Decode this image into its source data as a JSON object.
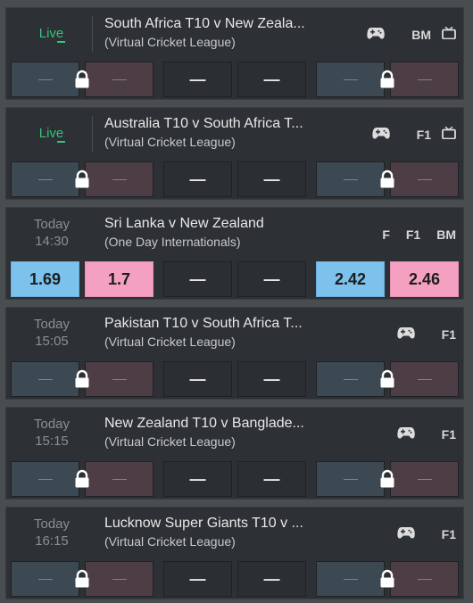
{
  "markets": [
    {
      "status": "live",
      "live_label": "Live",
      "day": "",
      "time": "",
      "title": "South Africa T10 v New Zeala...",
      "competition": "(Virtual Cricket League)",
      "badges": [
        "BM"
      ],
      "has_gamepad": true,
      "has_tv": true,
      "suspended": true,
      "odds": {
        "back1": "",
        "lay1": "",
        "draw_back": "—",
        "draw_lay": "—",
        "back2": "",
        "lay2": ""
      }
    },
    {
      "status": "live",
      "live_label": "Live",
      "day": "",
      "time": "",
      "title": "Australia T10 v South Africa T...",
      "competition": "(Virtual Cricket League)",
      "badges": [
        "F1"
      ],
      "has_gamepad": true,
      "has_tv": true,
      "suspended": true,
      "odds": {
        "back1": "",
        "lay1": "",
        "draw_back": "—",
        "draw_lay": "—",
        "back2": "",
        "lay2": ""
      }
    },
    {
      "status": "scheduled",
      "live_label": "",
      "day": "Today",
      "time": "14:30",
      "title": "Sri Lanka v New Zealand",
      "competition": "(One Day Internationals)",
      "badges": [
        "F",
        "F1",
        "BM"
      ],
      "has_gamepad": false,
      "has_tv": false,
      "suspended": false,
      "odds": {
        "back1": "1.69",
        "lay1": "1.7",
        "draw_back": "—",
        "draw_lay": "—",
        "back2": "2.42",
        "lay2": "2.46"
      }
    },
    {
      "status": "scheduled",
      "live_label": "",
      "day": "Today",
      "time": "15:05",
      "title": "Pakistan T10 v South Africa T...",
      "competition": "(Virtual Cricket League)",
      "badges": [
        "F1"
      ],
      "has_gamepad": true,
      "has_tv": false,
      "suspended": true,
      "odds": {
        "back1": "",
        "lay1": "",
        "draw_back": "—",
        "draw_lay": "—",
        "back2": "",
        "lay2": ""
      }
    },
    {
      "status": "scheduled",
      "live_label": "",
      "day": "Today",
      "time": "15:15",
      "title": "New Zealand T10 v Banglade...",
      "competition": "(Virtual Cricket League)",
      "badges": [
        "F1"
      ],
      "has_gamepad": true,
      "has_tv": false,
      "suspended": true,
      "odds": {
        "back1": "",
        "lay1": "",
        "draw_back": "—",
        "draw_lay": "—",
        "back2": "",
        "lay2": ""
      }
    },
    {
      "status": "scheduled",
      "live_label": "",
      "day": "Today",
      "time": "16:15",
      "title": "Lucknow Super Giants T10 v ...",
      "competition": "(Virtual Cricket League)",
      "badges": [
        "F1"
      ],
      "has_gamepad": true,
      "has_tv": false,
      "suspended": true,
      "odds": {
        "back1": "",
        "lay1": "",
        "draw_back": "—",
        "draw_lay": "—",
        "back2": "",
        "lay2": ""
      }
    }
  ],
  "icons": {
    "gamepad": "gamepad-icon",
    "tv": "tv-icon",
    "lock": "lock-icon"
  },
  "colors": {
    "live": "#35c47a",
    "back": "#7cc2ec",
    "lay": "#f4a0c1",
    "card": "#2d3034",
    "background": "#4a4d50"
  }
}
